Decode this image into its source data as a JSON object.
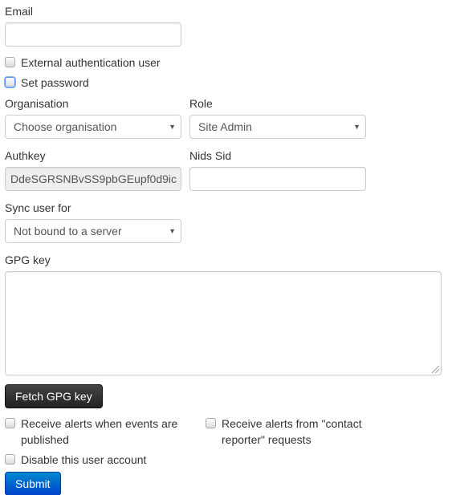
{
  "form": {
    "email": {
      "label": "Email",
      "value": ""
    },
    "external_auth": {
      "label": "External authentication user",
      "checked": false
    },
    "set_password": {
      "label": "Set password",
      "checked": false
    },
    "organisation": {
      "label": "Organisation",
      "selected": "Choose organisation"
    },
    "role": {
      "label": "Role",
      "selected": "Site Admin"
    },
    "authkey": {
      "label": "Authkey",
      "value": "DdeSGRSNBvSS9pbGEupf0d9ic"
    },
    "nids_sid": {
      "label": "Nids Sid",
      "value": ""
    },
    "sync_user": {
      "label": "Sync user for",
      "selected": "Not bound to a server"
    },
    "gpg_key": {
      "label": "GPG key",
      "value": ""
    },
    "fetch_gpg_button": "Fetch GPG key",
    "receive_alerts_published": {
      "label_line1": "Receive alerts when events are",
      "label_line2": "published",
      "checked": false
    },
    "receive_alerts_contact": {
      "label_line1": "Receive alerts from \"contact",
      "label_line2": "reporter\" requests",
      "checked": false
    },
    "disable_account": {
      "label": "Disable this user account",
      "checked": false
    },
    "submit_button": "Submit"
  },
  "icons": {
    "dropdown_caret": "▼"
  },
  "colors": {
    "primary": "#0055cc",
    "dark_button": "#222222",
    "disabled_input_bg": "#eeeeee",
    "focus_ring": "#4d90fe"
  }
}
